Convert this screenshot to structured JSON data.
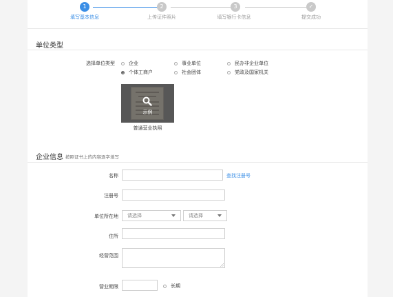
{
  "steps": [
    {
      "num": "1",
      "label": "填写基本信息",
      "active": true
    },
    {
      "num": "2",
      "label": "上传证件照片",
      "active": false
    },
    {
      "num": "3",
      "label": "填写银行卡信息",
      "active": false
    },
    {
      "num": "✓",
      "label": "提交成功",
      "active": false
    }
  ],
  "unit_type": {
    "title": "单位类型",
    "field_label": "选择单位类型",
    "options": [
      {
        "label": "企业",
        "checked": false
      },
      {
        "label": "事业单位",
        "checked": false
      },
      {
        "label": "民办非企业单位",
        "checked": false
      },
      {
        "label": "个体工商户",
        "checked": true
      },
      {
        "label": "社会团体",
        "checked": false
      },
      {
        "label": "党政及国家机关",
        "checked": false
      }
    ],
    "sample_label": "示例",
    "sample_caption": "普通营业执照"
  },
  "company": {
    "title": "企业信息",
    "hint": "按照证书上的内容逐字填写",
    "name_label": "名称",
    "lookup_link": "查找注册号",
    "reg_no_label": "注册号",
    "location_label": "单位所在地",
    "select1_placeholder": "请选择",
    "select2_placeholder": "请选择",
    "address_label": "住所",
    "scope_label": "经营范围",
    "term_label": "营业期限",
    "long_term_label": "长期"
  },
  "colors": {
    "accent": "#3a8ee6",
    "inactive": "#c9c9c9",
    "background": "#f4f4f4"
  }
}
